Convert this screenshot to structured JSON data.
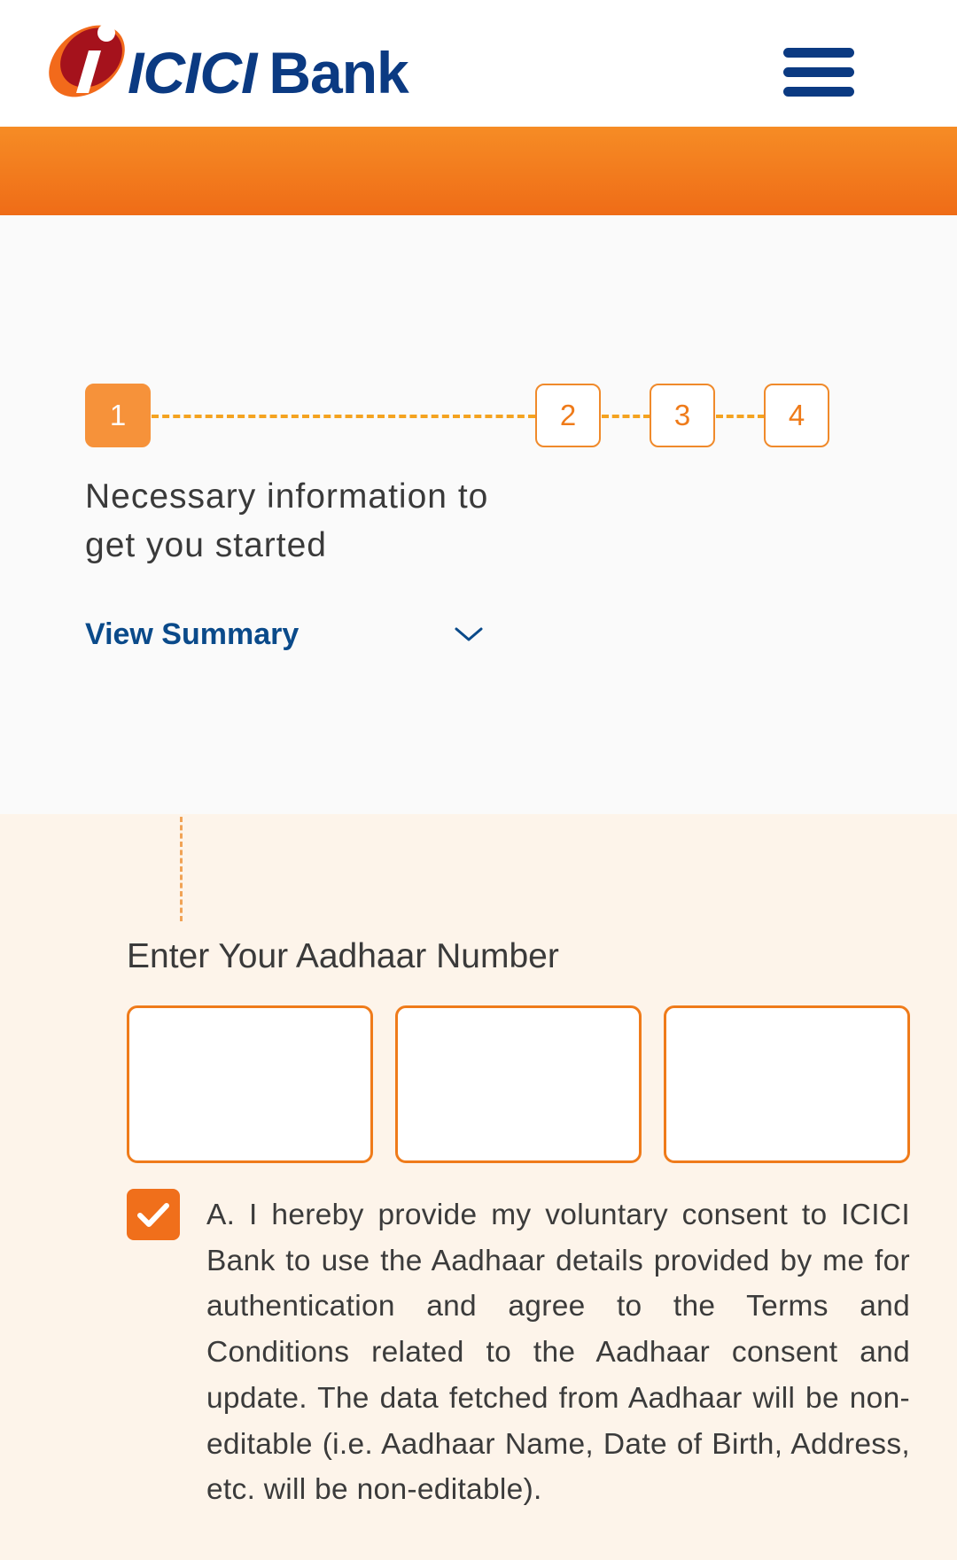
{
  "header": {
    "logo_text": "ICICI",
    "logo_bank": "Bank",
    "menu_icon": "hamburger-menu-icon",
    "brand_colors": {
      "blue": "#0b3a82",
      "orange": "#f68c25",
      "red": "#b5121b"
    }
  },
  "stepper": {
    "steps": [
      "1",
      "2",
      "3",
      "4"
    ],
    "current_step": "1",
    "caption": "Necessary information to get you started",
    "view_summary_label": "View Summary",
    "view_summary_icon": "chevron-down-icon"
  },
  "aadhaar": {
    "label": "Enter Your Aadhaar Number",
    "parts": [
      "",
      "",
      ""
    ]
  },
  "consent": {
    "checked": true,
    "checkbox_icon": "checkmark-icon",
    "text": "A. I hereby provide my voluntary consent to ICICI Bank to use the Aadhaar details provided by me for authentication and agree to the Terms and Conditions related to the Aadhaar consent and update. The data fetched from Aadhaar will be non-editable (i.e. Aadhaar Name, Date of Birth, Address, etc. will be non-editable)."
  }
}
